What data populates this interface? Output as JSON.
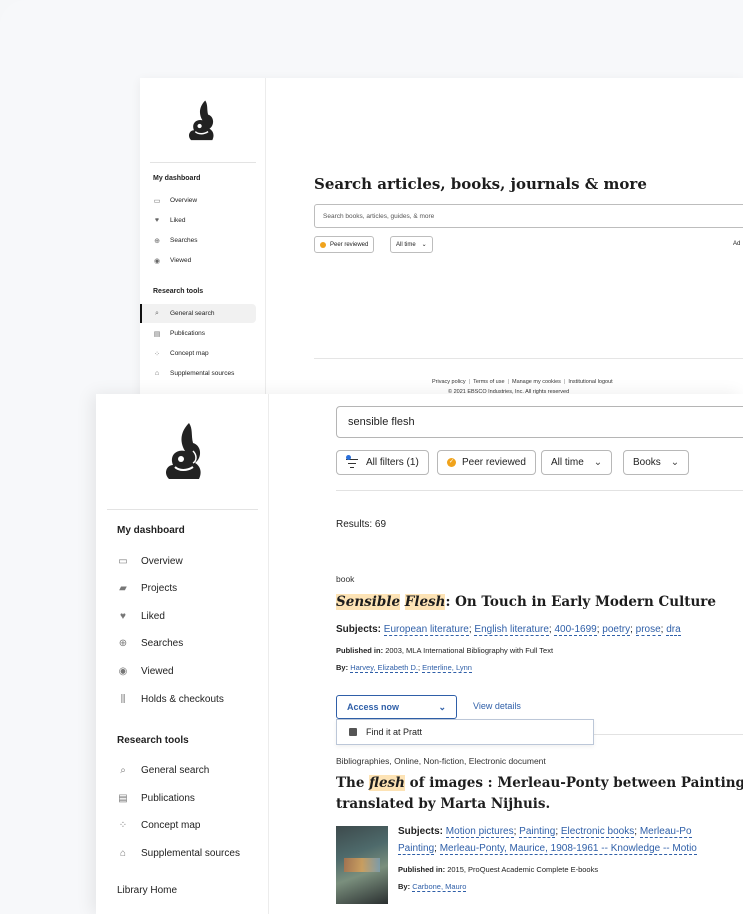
{
  "back": {
    "sidebar": {
      "section1": "My dashboard",
      "items1": [
        {
          "label": "Overview",
          "icon": "panel-icon"
        },
        {
          "label": "Liked",
          "icon": "heart-icon"
        },
        {
          "label": "Searches",
          "icon": "search-history-icon"
        },
        {
          "label": "Viewed",
          "icon": "eye-icon"
        }
      ],
      "section2": "Research tools",
      "items2": [
        {
          "label": "General search",
          "icon": "search-icon"
        },
        {
          "label": "Publications",
          "icon": "document-icon"
        },
        {
          "label": "Concept map",
          "icon": "concept-map-icon"
        },
        {
          "label": "Supplemental sources",
          "icon": "institution-icon"
        }
      ]
    },
    "title": "Search articles, books, journals & more",
    "search_placeholder": "Search books, articles, guides, & more",
    "chip_peer": "Peer reviewed",
    "chip_time": "All time",
    "advanced_partial": "Ad",
    "footer": {
      "privacy": "Privacy policy",
      "terms": "Terms of use",
      "cookies": "Manage my cookies",
      "logout": "Institutional logout",
      "copyright": "© 2021 EBSCO Industries, Inc. All rights reserved"
    }
  },
  "sidebar": {
    "section1": "My dashboard",
    "items1": [
      {
        "label": "Overview"
      },
      {
        "label": "Projects"
      },
      {
        "label": "Liked"
      },
      {
        "label": "Searches"
      },
      {
        "label": "Viewed"
      },
      {
        "label": "Holds & checkouts"
      }
    ],
    "section2": "Research tools",
    "items2": [
      {
        "label": "General search"
      },
      {
        "label": "Publications"
      },
      {
        "label": "Concept map"
      },
      {
        "label": "Supplemental sources"
      }
    ],
    "library_home": "Library Home"
  },
  "search": {
    "value": "sensible flesh"
  },
  "filters": {
    "all_filters": "All filters (1)",
    "peer": "Peer reviewed",
    "time": "All time",
    "books": "Books"
  },
  "results_label": "Results: 69",
  "results": [
    {
      "type": "book",
      "title_hl1": "Sensible",
      "title_hl2": "Flesh",
      "title_rest": ": On Touch in Early Modern Culture",
      "subjects_label": "Subjects:",
      "subjects": [
        "European literature",
        "English literature",
        "400-1699",
        "poetry",
        "prose",
        "dra"
      ],
      "published_label": "Published in:",
      "published": "2003, MLA International Bibliography with Full Text",
      "by_label": "By:",
      "authors": [
        "Harvey, Elizabeth D.",
        "Enterline, Lynn"
      ],
      "access_label": "Access now",
      "view_details": "View details",
      "dropdown_item": "Find it at Pratt"
    },
    {
      "type": "Bibliographies, Online, Non-fiction, Electronic document",
      "title_pre": "The ",
      "title_hl": "flesh",
      "title_rest": " of images : Merleau-Ponty between Painting and C",
      "title_line2": "translated by Marta Nijhuis.",
      "subjects_label": "Subjects:",
      "subjects": [
        "Motion pictures",
        "Painting",
        "Electronic books",
        "Merleau-Po"
      ],
      "subjects_line2": [
        "Painting",
        "Merleau-Ponty, Maurice, 1908-1961 -- Knowledge -- Motio"
      ],
      "published_label": "Published in:",
      "published": "2015, ProQuest Academic Complete E-books",
      "by_label": "By:",
      "authors": [
        "Carbone, Mauro"
      ]
    }
  ]
}
